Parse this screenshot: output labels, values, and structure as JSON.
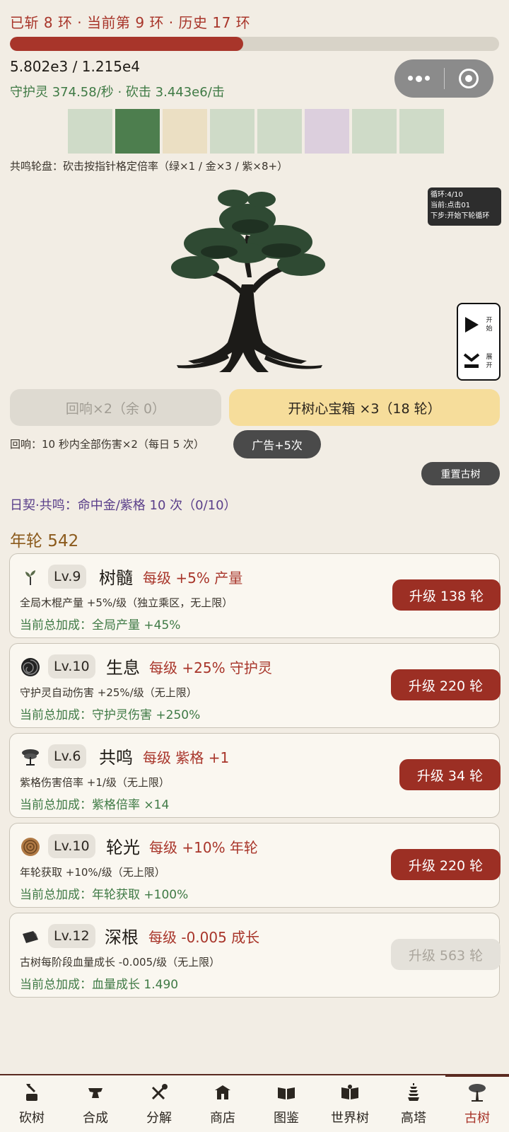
{
  "header": {
    "status": "已斩 8 环 · 当前第 9 环 · 历史 17 环",
    "hp_fraction": 0.477,
    "hp_text": "5.802e3 / 1.215e4",
    "dps_text": "守护灵 374.58/秒 · 砍击 3.443e6/击"
  },
  "wheel": {
    "cells": [
      "#cfdbc8",
      "#4d7e4e",
      "#ebdfc3",
      "#cfdbc8",
      "#cfdbc8",
      "#dccfdd",
      "#cfdbc8",
      "#cfdbc8"
    ],
    "description": "共鸣轮盘：砍击按指针格定倍率（绿×1 / 金×3 / 紫×8+）"
  },
  "loop_info": {
    "line1": "循环:4/10",
    "line2": "当前:点击01",
    "line3": "下步:开始下轮循环"
  },
  "side_control": {
    "play_label": "开始",
    "expand_label": "展开"
  },
  "actions": {
    "echo_button": "回响×2（余 0）",
    "chest_button": "开树心宝箱 ×3（18 轮）",
    "echo_desc": "回响：10 秒内全部伤害×2（每日 5 次）",
    "ad_button": "广告+5次",
    "reset_button": "重置古树"
  },
  "daily": "日契·共鸣：命中金/紫格 10 次（0/10）",
  "rings": "年轮 542",
  "upgrades": [
    {
      "icon": "sprout-icon",
      "level": "Lv.9",
      "name": "树髓",
      "per_level": "每级 +5% 产量",
      "desc": "全局木棍产量 +5%/级（独立乘区，无上限）",
      "total": "当前总加成：全局产量 +45%",
      "button": "升级 138 轮",
      "enabled": true
    },
    {
      "icon": "swirl-icon",
      "level": "Lv.10",
      "name": "生息",
      "per_level": "每级 +25% 守护灵",
      "desc": "守护灵自动伤害 +25%/级（无上限）",
      "total": "当前总加成：守护灵伤害 +250%",
      "button": "升级 220 轮",
      "enabled": true
    },
    {
      "icon": "tree-icon",
      "level": "Lv.6",
      "name": "共鸣",
      "per_level": "每级 紫格 +1",
      "desc": "紫格伤害倍率 +1/级（无上限）",
      "total": "当前总加成：紫格倍率 ×14",
      "button": "升级 34 轮",
      "enabled": true
    },
    {
      "icon": "wood-ring-icon",
      "level": "Lv.10",
      "name": "轮光",
      "per_level": "每级 +10% 年轮",
      "desc": "年轮获取 +10%/级（无上限）",
      "total": "当前总加成：年轮获取 +100%",
      "button": "升级 220 轮",
      "enabled": true
    },
    {
      "icon": "root-icon",
      "level": "Lv.12",
      "name": "深根",
      "per_level": "每级 -0.005 成长",
      "desc": "古树每阶段血量成长 -0.005/级（无上限）",
      "total": "当前总加成：血量成长 1.490",
      "button": "升级 563 轮",
      "enabled": false
    }
  ],
  "nav": [
    {
      "label": "砍树",
      "icon": "axe-stump-icon"
    },
    {
      "label": "合成",
      "icon": "anvil-icon"
    },
    {
      "label": "分解",
      "icon": "tools-icon"
    },
    {
      "label": "商店",
      "icon": "shop-icon"
    },
    {
      "label": "图鉴",
      "icon": "book-icon"
    },
    {
      "label": "世界树",
      "icon": "world-book-icon"
    },
    {
      "label": "高塔",
      "icon": "pagoda-icon"
    },
    {
      "label": "古树",
      "icon": "ancient-tree-icon",
      "active": true
    }
  ]
}
